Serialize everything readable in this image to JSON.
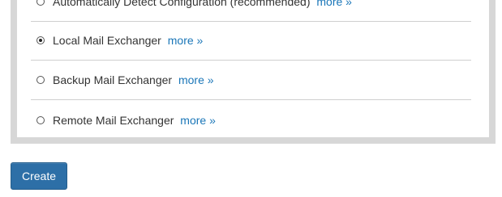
{
  "mail_exchanger": {
    "options": [
      {
        "label": "Automatically Detect Configuration (recommended)",
        "link_text": "more »",
        "selected": false
      },
      {
        "label": "Local Mail Exchanger",
        "link_text": "more »",
        "selected": true
      },
      {
        "label": "Backup Mail Exchanger",
        "link_text": "more »",
        "selected": false
      },
      {
        "label": "Remote Mail Exchanger",
        "link_text": "more »",
        "selected": false
      }
    ]
  },
  "actions": {
    "create_label": "Create"
  },
  "colors": {
    "link": "#1a76b8",
    "button": "#2d6fa7",
    "panel_border": "#d7d7d7"
  }
}
